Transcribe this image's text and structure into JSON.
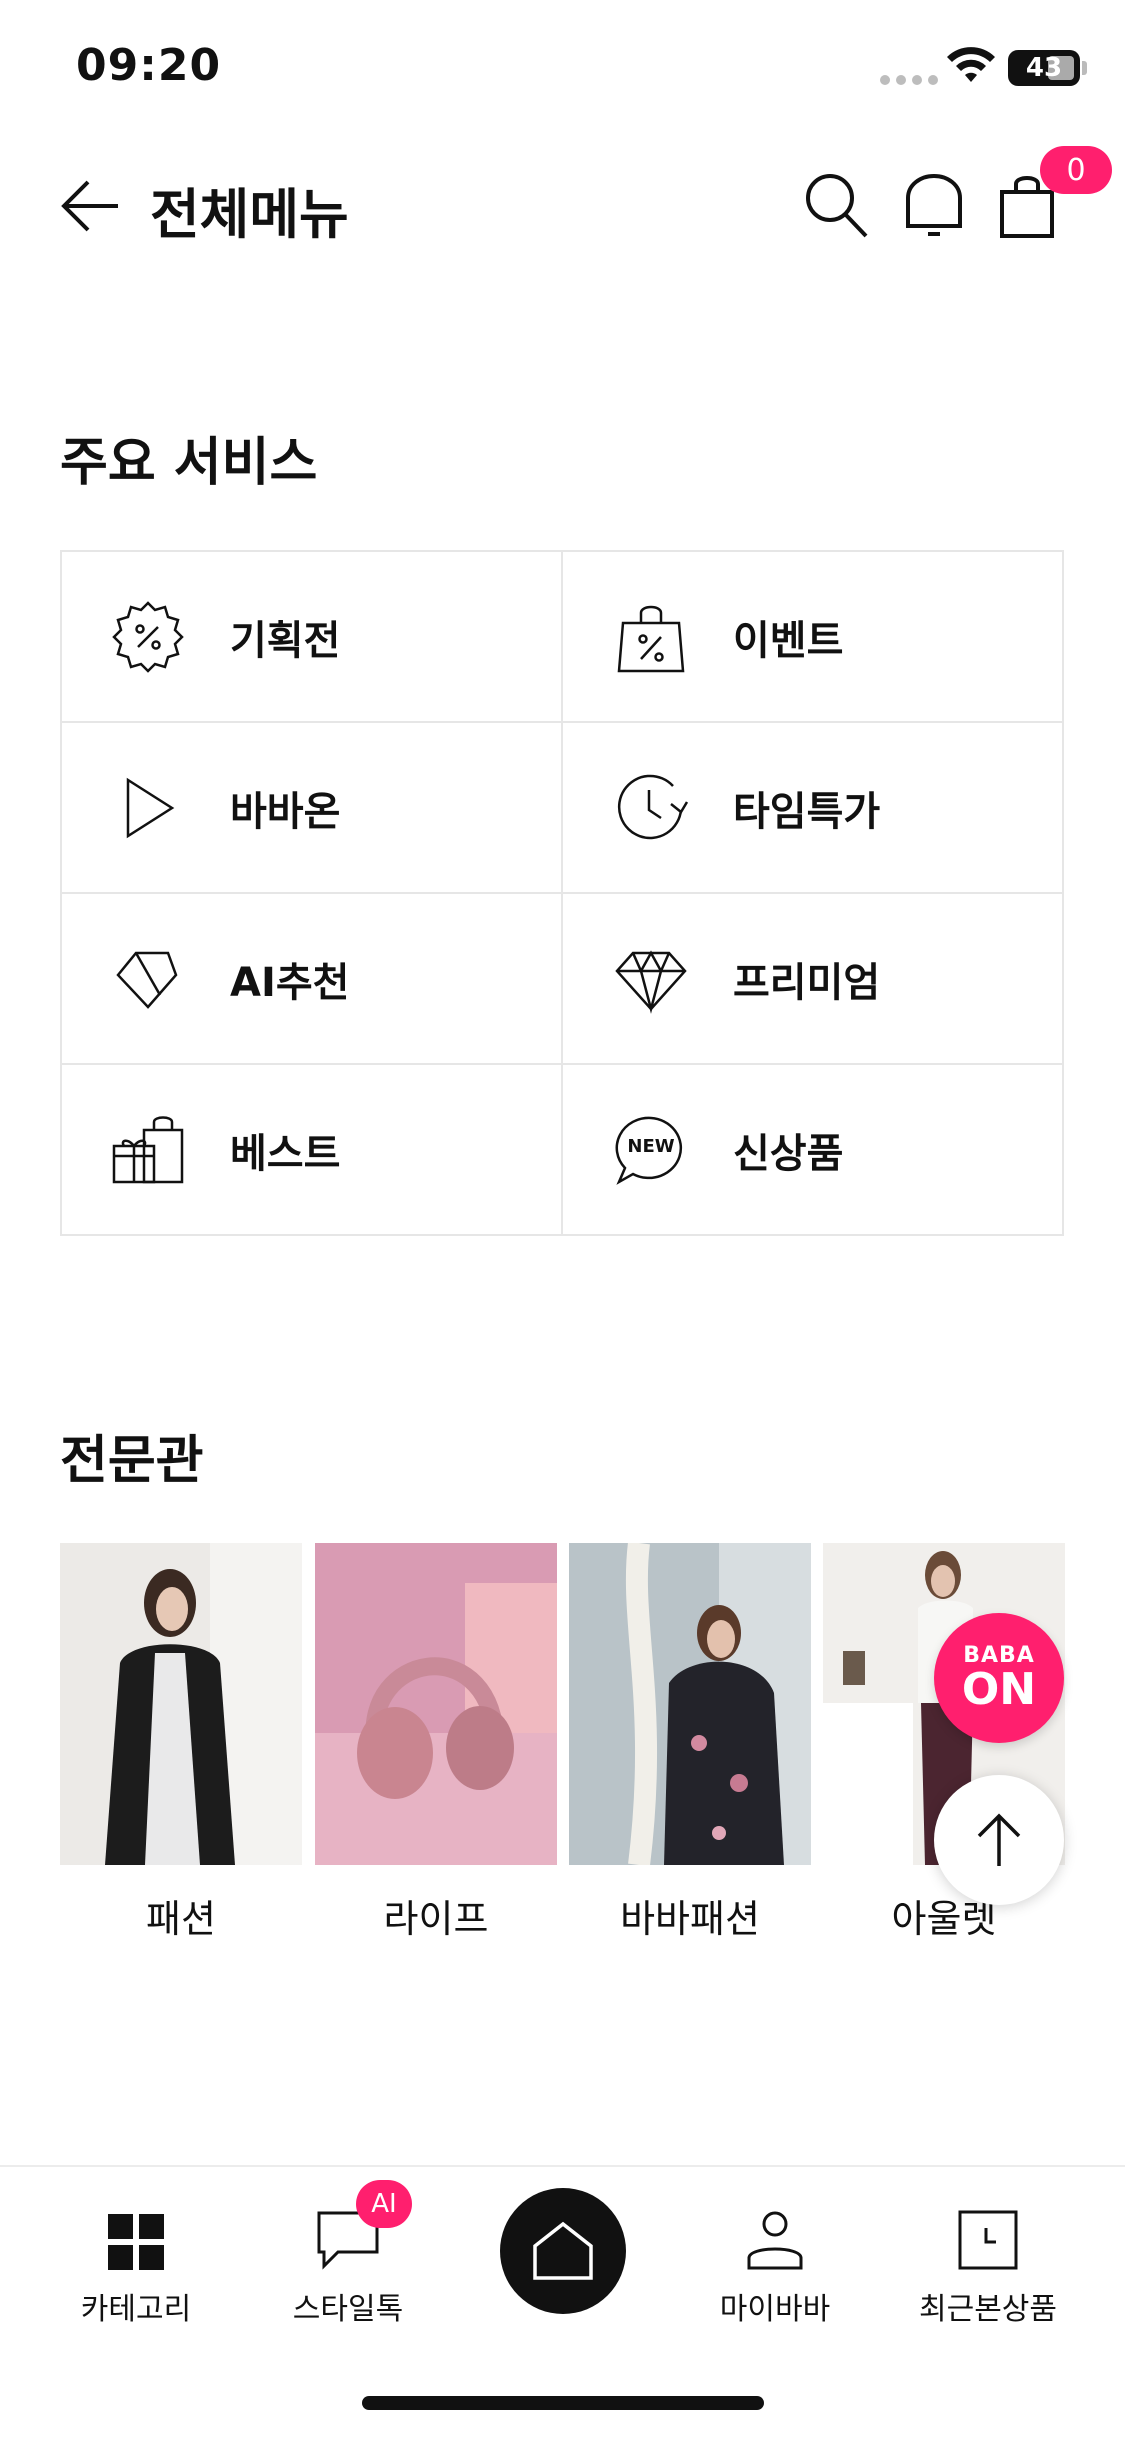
{
  "status_bar": {
    "time": "09:20",
    "battery": "43"
  },
  "header": {
    "title": "전체메뉴",
    "cart_count": "0"
  },
  "main_services": {
    "title": "주요 서비스",
    "items": [
      {
        "label": "기획전",
        "icon": "percent-badge-icon"
      },
      {
        "label": "이벤트",
        "icon": "shopping-bag-percent-icon"
      },
      {
        "label": "바바온",
        "icon": "play-icon"
      },
      {
        "label": "타임특가",
        "icon": "clock-icon"
      },
      {
        "label": "AI추천",
        "icon": "gem-outline-icon"
      },
      {
        "label": "프리미엄",
        "icon": "diamond-icon"
      },
      {
        "label": "베스트",
        "icon": "gift-icon"
      },
      {
        "label": "신상품",
        "icon": "new-chat-icon"
      }
    ],
    "new_icon_text": "NEW"
  },
  "specialty": {
    "title": "전문관",
    "items": [
      {
        "label": "패션"
      },
      {
        "label": "라이프"
      },
      {
        "label": "바바패션"
      },
      {
        "label": "아울렛"
      }
    ]
  },
  "floating": {
    "baba_top": "BABA",
    "baba_bottom": "ON"
  },
  "bottom_nav": {
    "items": [
      {
        "label": "카테고리"
      },
      {
        "label": "스타일톡"
      },
      {
        "label": "마이바바"
      },
      {
        "label": "최근본상품"
      }
    ],
    "ai_badge": "AI"
  },
  "colors": {
    "accent": "#ff1f6e",
    "border": "#e6e6e6",
    "text": "#111111"
  }
}
